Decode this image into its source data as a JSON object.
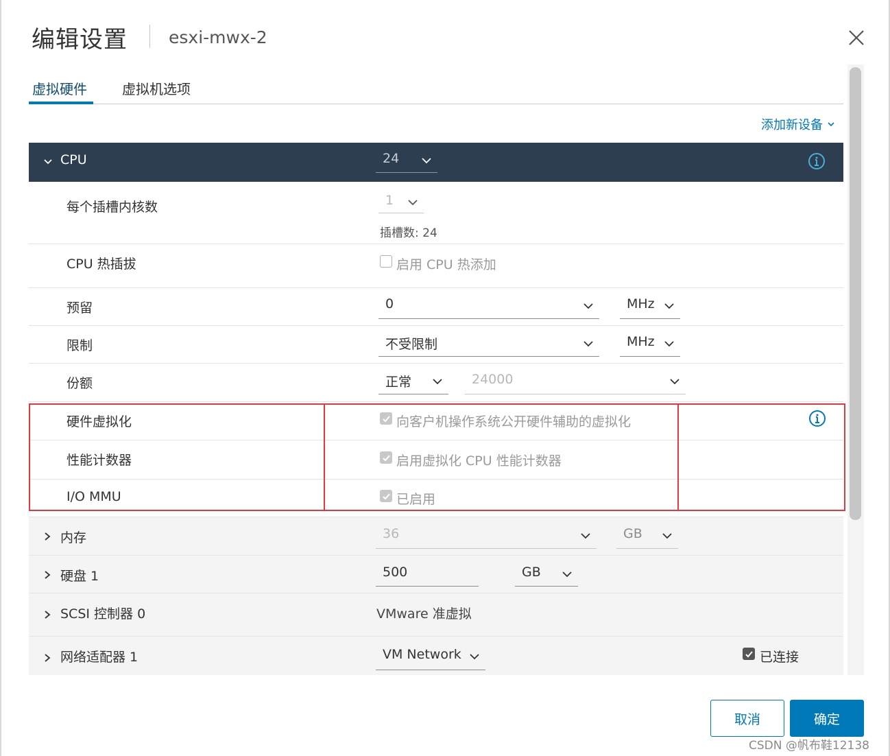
{
  "dialog": {
    "title": "编辑设置",
    "vm_name": "esxi-mwx-2"
  },
  "tabs": [
    {
      "label": "虚拟硬件",
      "active": true
    },
    {
      "label": "虚拟机选项",
      "active": false
    }
  ],
  "add_device_label": "添加新设备",
  "cpu": {
    "label": "CPU",
    "count": "24",
    "cores_per_socket_label": "每个插槽内核数",
    "cores_per_socket": "1",
    "sockets_text": "插槽数: 24",
    "hotplug_label": "CPU 热插拔",
    "hotplug_option": "启用 CPU 热添加",
    "reservation_label": "预留",
    "reservation_value": "0",
    "reservation_unit": "MHz",
    "limit_label": "限制",
    "limit_value": "不受限制",
    "limit_unit": "MHz",
    "shares_label": "份额",
    "shares_level": "正常",
    "shares_value": "24000",
    "hw_virt_label": "硬件虚拟化",
    "hw_virt_option": "向客户机操作系统公开硬件辅助的虚拟化",
    "perf_counter_label": "性能计数器",
    "perf_counter_option": "启用虚拟化 CPU 性能计数器",
    "iommu_label": "I/O MMU",
    "iommu_option": "已启用"
  },
  "memory": {
    "label": "内存",
    "value": "36",
    "unit": "GB"
  },
  "disk": {
    "label": "硬盘 1",
    "value": "500",
    "unit": "GB"
  },
  "scsi": {
    "label": "SCSI 控制器 0",
    "value": "VMware 准虚拟"
  },
  "network": {
    "label": "网络适配器 1",
    "value": "VM Network",
    "connected_label": "已连接"
  },
  "buttons": {
    "cancel": "取消",
    "ok": "确定"
  },
  "watermark": "CSDN @帆布鞋12138",
  "colors": {
    "accent": "#0079b8",
    "header_bg": "#2d3e50",
    "highlight": "#e23a3a"
  }
}
